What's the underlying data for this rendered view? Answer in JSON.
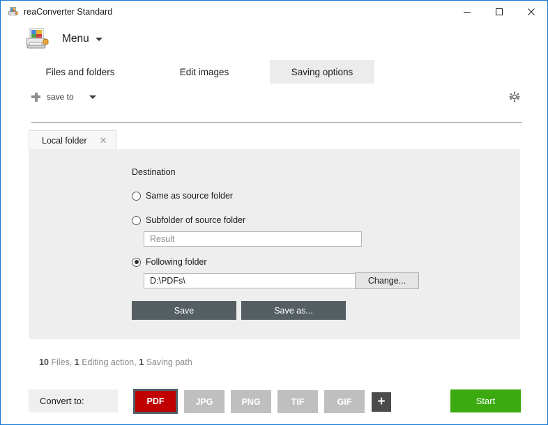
{
  "window": {
    "title": "reaConverter Standard",
    "icon": "printer-icon",
    "controls": {
      "minimize": "minimize-icon",
      "maximize": "maximize-icon",
      "close": "close-icon"
    },
    "border_color": "#1378d4"
  },
  "menu": {
    "label": "Menu",
    "logo_icon": "printer-image-icon",
    "caret": "chevron-down-icon"
  },
  "tabs": [
    {
      "label": "Files and folders",
      "active": false
    },
    {
      "label": "Edit images",
      "active": false
    },
    {
      "label": "Saving options",
      "active": true
    }
  ],
  "toolbar": {
    "add_icon": "plus-icon",
    "save_to_label": "save to",
    "dropdown_caret": "chevron-down-icon",
    "settings_icon": "gear-icon"
  },
  "subtabs": [
    {
      "label": "Local folder",
      "close_icon": "close-icon",
      "active": true
    }
  ],
  "destination": {
    "title": "Destination",
    "options": [
      {
        "label": "Same as source folder",
        "selected": false
      },
      {
        "label": "Subfolder of source folder",
        "selected": false
      },
      {
        "label": "Following folder",
        "selected": true
      }
    ],
    "subfolder_input": {
      "value": "",
      "placeholder": "Result"
    },
    "folder_input": {
      "value": "D:\\PDFs\\",
      "placeholder": ""
    },
    "change_button": "Change...",
    "save_button": "Save",
    "save_as_button": "Save as..."
  },
  "status": {
    "files_count": "10",
    "files_label": "Files,",
    "editing_count": "1",
    "editing_label": "Editing action,",
    "saving_count": "1",
    "saving_label": "Saving path"
  },
  "bottom": {
    "convert_label": "Convert to:",
    "formats": [
      {
        "label": "PDF",
        "active": true,
        "color": "#c00000"
      },
      {
        "label": "JPG",
        "active": false,
        "color": "#bfbfbf"
      },
      {
        "label": "PNG",
        "active": false,
        "color": "#bfbfbf"
      },
      {
        "label": "TIF",
        "active": false,
        "color": "#bfbfbf"
      },
      {
        "label": "GIF",
        "active": false,
        "color": "#bfbfbf"
      }
    ],
    "add_format_icon": "plus-icon",
    "add_format_label": "+",
    "start_button": "Start",
    "start_color": "#3aaa10"
  }
}
